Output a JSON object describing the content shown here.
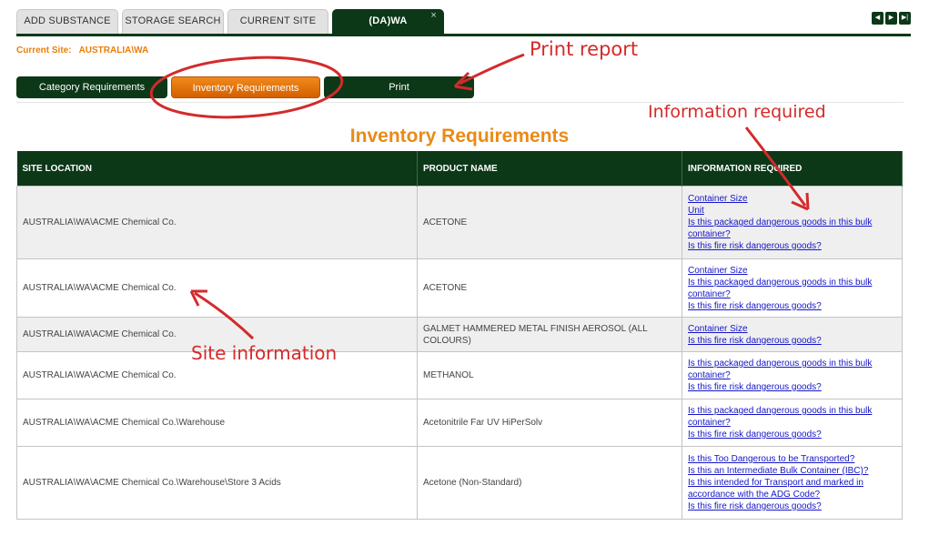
{
  "tabs": [
    {
      "label": "ADD SUBSTANCE"
    },
    {
      "label": "STORAGE SEARCH"
    },
    {
      "label": "CURRENT SITE"
    },
    {
      "label": "(DA)WA",
      "close": "×"
    }
  ],
  "current_site": {
    "label": "Current Site:",
    "value": "AUSTRALIA\\WA"
  },
  "buttons": {
    "category": "Category Requirements",
    "inventory": "Inventory Requirements",
    "print": "Print"
  },
  "page_title": "Inventory Requirements",
  "table": {
    "headers": [
      "SITE LOCATION",
      "PRODUCT NAME",
      "INFORMATION REQUIRED"
    ],
    "rows": [
      {
        "site": "AUSTRALIA\\WA\\ACME Chemical Co.",
        "product": "ACETONE",
        "info": [
          "Container Size",
          "Unit",
          "Is this packaged dangerous goods in this bulk container?",
          "Is this fire risk dangerous goods?"
        ]
      },
      {
        "site": "AUSTRALIA\\WA\\ACME Chemical Co.",
        "product": "ACETONE",
        "info": [
          "Container Size",
          "Is this packaged dangerous goods in this bulk container?",
          "Is this fire risk dangerous goods?"
        ]
      },
      {
        "site": "AUSTRALIA\\WA\\ACME Chemical Co.",
        "product": "GALMET HAMMERED METAL FINISH AEROSOL (ALL COLOURS)",
        "info": [
          "Container Size",
          "Is this fire risk dangerous goods?"
        ]
      },
      {
        "site": "AUSTRALIA\\WA\\ACME Chemical Co.",
        "product": "METHANOL",
        "info": [
          "Is this packaged dangerous goods in this bulk container?",
          "Is this fire risk dangerous goods?"
        ]
      },
      {
        "site": "AUSTRALIA\\WA\\ACME Chemical Co.\\Warehouse",
        "product": "Acetonitrile Far UV HiPerSolv",
        "info": [
          "Is this packaged dangerous goods in this bulk container?",
          "Is this fire risk dangerous goods?"
        ]
      },
      {
        "site": "AUSTRALIA\\WA\\ACME Chemical Co.\\Warehouse\\Store 3 Acids",
        "product": "Acetone (Non-Standard)",
        "info": [
          "Is this Too Dangerous to be Transported?",
          "Is this an Intermediate Bulk Container (IBC)?",
          "Is this intended for Transport and marked in accordance with the ADG Code?",
          "Is this fire risk dangerous goods?"
        ]
      }
    ]
  },
  "annotations": {
    "print_report": "Print report",
    "information_required": "Information required",
    "site_information": "Site information"
  },
  "colors": {
    "dark_green": "#0c3818",
    "orange": "#e87f0a",
    "link": "#1515c8",
    "annotation": "#d42a2a"
  }
}
